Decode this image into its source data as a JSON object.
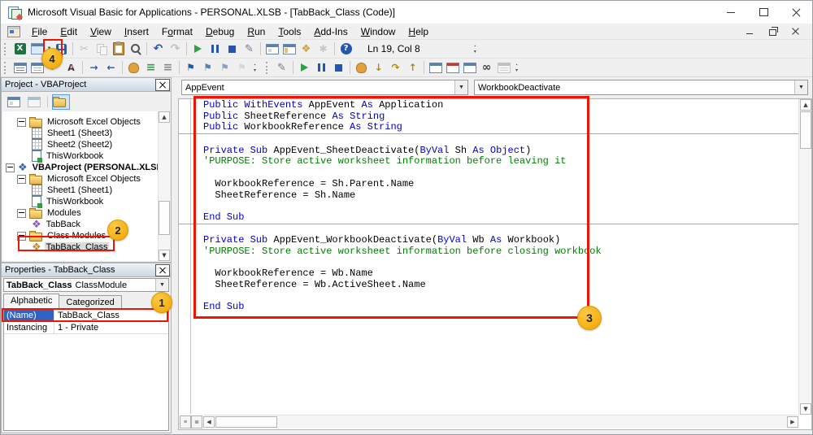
{
  "window": {
    "title": "Microsoft Visual Basic for Applications - PERSONAL.XLSB - [TabBack_Class (Code)]"
  },
  "colors": {
    "keyword_blue": "#0000cc",
    "comment_green": "#008000",
    "annotation_red": "#ee1506",
    "badge_orange": "#f5a800",
    "selection_blue": "#2f63c4"
  },
  "menu": {
    "items": [
      {
        "label": "File",
        "u": 0
      },
      {
        "label": "Edit",
        "u": 0
      },
      {
        "label": "View",
        "u": 0
      },
      {
        "label": "Insert",
        "u": 0
      },
      {
        "label": "Format",
        "u": 1
      },
      {
        "label": "Debug",
        "u": 0
      },
      {
        "label": "Run",
        "u": 0
      },
      {
        "label": "Tools",
        "u": 0
      },
      {
        "label": "Add-Ins",
        "u": 0
      },
      {
        "label": "Window",
        "u": 0
      },
      {
        "label": "Help",
        "u": 0
      }
    ]
  },
  "toolbar_standard": {
    "status": "Ln 19, Col 8",
    "groups": [
      {
        "icons": [
          {
            "name": "excel"
          },
          {
            "name": "insert-userform",
            "dropdown": true
          },
          {
            "name": "save"
          }
        ]
      },
      {
        "icons": [
          {
            "name": "cut",
            "disabled": true
          },
          {
            "name": "copy",
            "disabled": true
          },
          {
            "name": "paste"
          },
          {
            "name": "find"
          }
        ]
      },
      {
        "icons": [
          {
            "name": "undo"
          },
          {
            "name": "redo",
            "disabled": true
          }
        ]
      },
      {
        "icons": [
          {
            "name": "run"
          },
          {
            "name": "break"
          },
          {
            "name": "reset"
          },
          {
            "name": "design-mode"
          }
        ]
      },
      {
        "icons": [
          {
            "name": "project-explorer"
          },
          {
            "name": "properties-window"
          },
          {
            "name": "object-browser"
          },
          {
            "name": "toolbox",
            "disabled": true
          }
        ]
      },
      {
        "icons": [
          {
            "name": "help"
          }
        ]
      }
    ]
  },
  "toolbar_edit": {
    "groups": [
      {
        "icons": [
          {
            "name": "list-properties"
          },
          {
            "name": "list-constants"
          },
          {
            "name": "quick-info"
          },
          {
            "name": "complete-word"
          }
        ]
      },
      {
        "icons": [
          {
            "name": "indent"
          },
          {
            "name": "outdent"
          }
        ]
      },
      {
        "icons": [
          {
            "name": "toggle-breakpoint"
          },
          {
            "name": "comment-block"
          },
          {
            "name": "uncomment-block"
          }
        ]
      },
      {
        "icons": [
          {
            "name": "toggle-bookmark"
          },
          {
            "name": "next-bookmark"
          },
          {
            "name": "previous-bookmark"
          },
          {
            "name": "clear-bookmarks",
            "disabled": true
          }
        ]
      }
    ]
  },
  "toolbar_debug": {
    "groups": [
      {
        "icons": [
          {
            "name": "design-mode"
          }
        ]
      },
      {
        "icons": [
          {
            "name": "run"
          },
          {
            "name": "break"
          },
          {
            "name": "reset"
          }
        ]
      },
      {
        "icons": [
          {
            "name": "toggle-breakpoint"
          },
          {
            "name": "step-into"
          },
          {
            "name": "step-over"
          },
          {
            "name": "step-out"
          }
        ]
      },
      {
        "icons": [
          {
            "name": "locals-window"
          },
          {
            "name": "immediate-window"
          },
          {
            "name": "watch-window"
          },
          {
            "name": "quick-watch"
          },
          {
            "name": "call-stack",
            "disabled": true
          }
        ]
      }
    ]
  },
  "project_panel": {
    "title": "Project - VBAProject",
    "tools": [
      {
        "name": "view-code"
      },
      {
        "name": "view-object"
      },
      {
        "name": "toggle-folders",
        "active": true
      }
    ],
    "tree": [
      {
        "depth": 1,
        "expand": true,
        "icon": "folder",
        "label": "Microsoft Excel Objects"
      },
      {
        "depth": 2,
        "icon": "sheet",
        "label": "Sheet1 (Sheet3)"
      },
      {
        "depth": 2,
        "icon": "sheet",
        "label": "Sheet2 (Sheet2)"
      },
      {
        "depth": 2,
        "icon": "workbook",
        "label": "ThisWorkbook"
      },
      {
        "depth": 0,
        "expand": true,
        "icon": "project",
        "label": "VBAProject (PERSONAL.XLSB)",
        "bold": true
      },
      {
        "depth": 1,
        "expand": true,
        "icon": "folder",
        "label": "Microsoft Excel Objects"
      },
      {
        "depth": 2,
        "icon": "sheet",
        "label": "Sheet1 (Sheet1)"
      },
      {
        "depth": 2,
        "icon": "workbook",
        "label": "ThisWorkbook"
      },
      {
        "depth": 1,
        "expand": true,
        "icon": "folder",
        "label": "Modules"
      },
      {
        "depth": 2,
        "icon": "module",
        "label": "TabBack"
      },
      {
        "depth": 1,
        "expand": true,
        "icon": "folder",
        "label": "Class Modules"
      },
      {
        "depth": 2,
        "icon": "classmodule",
        "label": "TabBack_Class",
        "selected": true
      }
    ]
  },
  "properties_panel": {
    "title": "Properties - TabBack_Class",
    "object_name": "TabBack_Class",
    "object_type": "ClassModule",
    "tabs": [
      {
        "label": "Alphabetic",
        "active": true
      },
      {
        "label": "Categorized"
      }
    ],
    "rows": [
      {
        "name": "(Name)",
        "value": "TabBack_Class",
        "selected": true
      },
      {
        "name": "Instancing",
        "value": "1 - Private"
      }
    ]
  },
  "code_panel": {
    "object_dropdown": "AppEvent",
    "procedure_dropdown": "WorkbookDeactivate",
    "lines": [
      {
        "tokens": [
          {
            "c": "k",
            "t": "Public "
          },
          {
            "c": "k",
            "t": "WithEvents "
          },
          {
            "c": "n",
            "t": "AppEvent "
          },
          {
            "c": "k",
            "t": "As "
          },
          {
            "c": "n",
            "t": "Application"
          }
        ]
      },
      {
        "tokens": [
          {
            "c": "k",
            "t": "Public "
          },
          {
            "c": "n",
            "t": "SheetReference "
          },
          {
            "c": "k",
            "t": "As "
          },
          {
            "c": "k",
            "t": "String"
          }
        ]
      },
      {
        "tokens": [
          {
            "c": "k",
            "t": "Public "
          },
          {
            "c": "n",
            "t": "WorkbookReference "
          },
          {
            "c": "k",
            "t": "As "
          },
          {
            "c": "k",
            "t": "String"
          }
        ],
        "sep_after": true
      },
      {
        "tokens": []
      },
      {
        "tokens": [
          {
            "c": "k",
            "t": "Private "
          },
          {
            "c": "k",
            "t": "Sub "
          },
          {
            "c": "n",
            "t": "AppEvent_SheetDeactivate("
          },
          {
            "c": "k",
            "t": "ByVal "
          },
          {
            "c": "n",
            "t": "Sh "
          },
          {
            "c": "k",
            "t": "As "
          },
          {
            "c": "k",
            "t": "Object"
          },
          {
            "c": "n",
            "t": ")"
          }
        ]
      },
      {
        "tokens": [
          {
            "c": "c",
            "t": "'PURPOSE: Store active worksheet information before leaving it"
          }
        ]
      },
      {
        "tokens": []
      },
      {
        "tokens": [
          {
            "c": "n",
            "t": "  WorkbookReference = Sh.Parent.Name"
          }
        ]
      },
      {
        "tokens": [
          {
            "c": "n",
            "t": "  SheetReference = Sh.Name"
          }
        ]
      },
      {
        "tokens": []
      },
      {
        "tokens": [
          {
            "c": "k",
            "t": "End Sub"
          }
        ],
        "sep_after": true
      },
      {
        "tokens": []
      },
      {
        "tokens": [
          {
            "c": "k",
            "t": "Private "
          },
          {
            "c": "k",
            "t": "Sub "
          },
          {
            "c": "n",
            "t": "AppEvent_WorkbookDeactivate("
          },
          {
            "c": "k",
            "t": "ByVal "
          },
          {
            "c": "n",
            "t": "Wb "
          },
          {
            "c": "k",
            "t": "As "
          },
          {
            "c": "n",
            "t": "Workbook"
          },
          {
            "c": "n",
            "t": ")"
          }
        ]
      },
      {
        "tokens": [
          {
            "c": "c",
            "t": "'PURPOSE: Store active worksheet information before closing workbook"
          }
        ]
      },
      {
        "tokens": []
      },
      {
        "tokens": [
          {
            "c": "n",
            "t": "  WorkbookReference = Wb.Name"
          }
        ]
      },
      {
        "tokens": [
          {
            "c": "n",
            "t": "  SheetReference = Wb.ActiveSheet.Name"
          }
        ]
      },
      {
        "tokens": []
      },
      {
        "tokens": [
          {
            "c": "k",
            "t": "End Sub"
          }
        ]
      }
    ]
  },
  "annotations": {
    "badge1": "1",
    "badge2": "2",
    "badge3": "3",
    "badge4": "4"
  }
}
